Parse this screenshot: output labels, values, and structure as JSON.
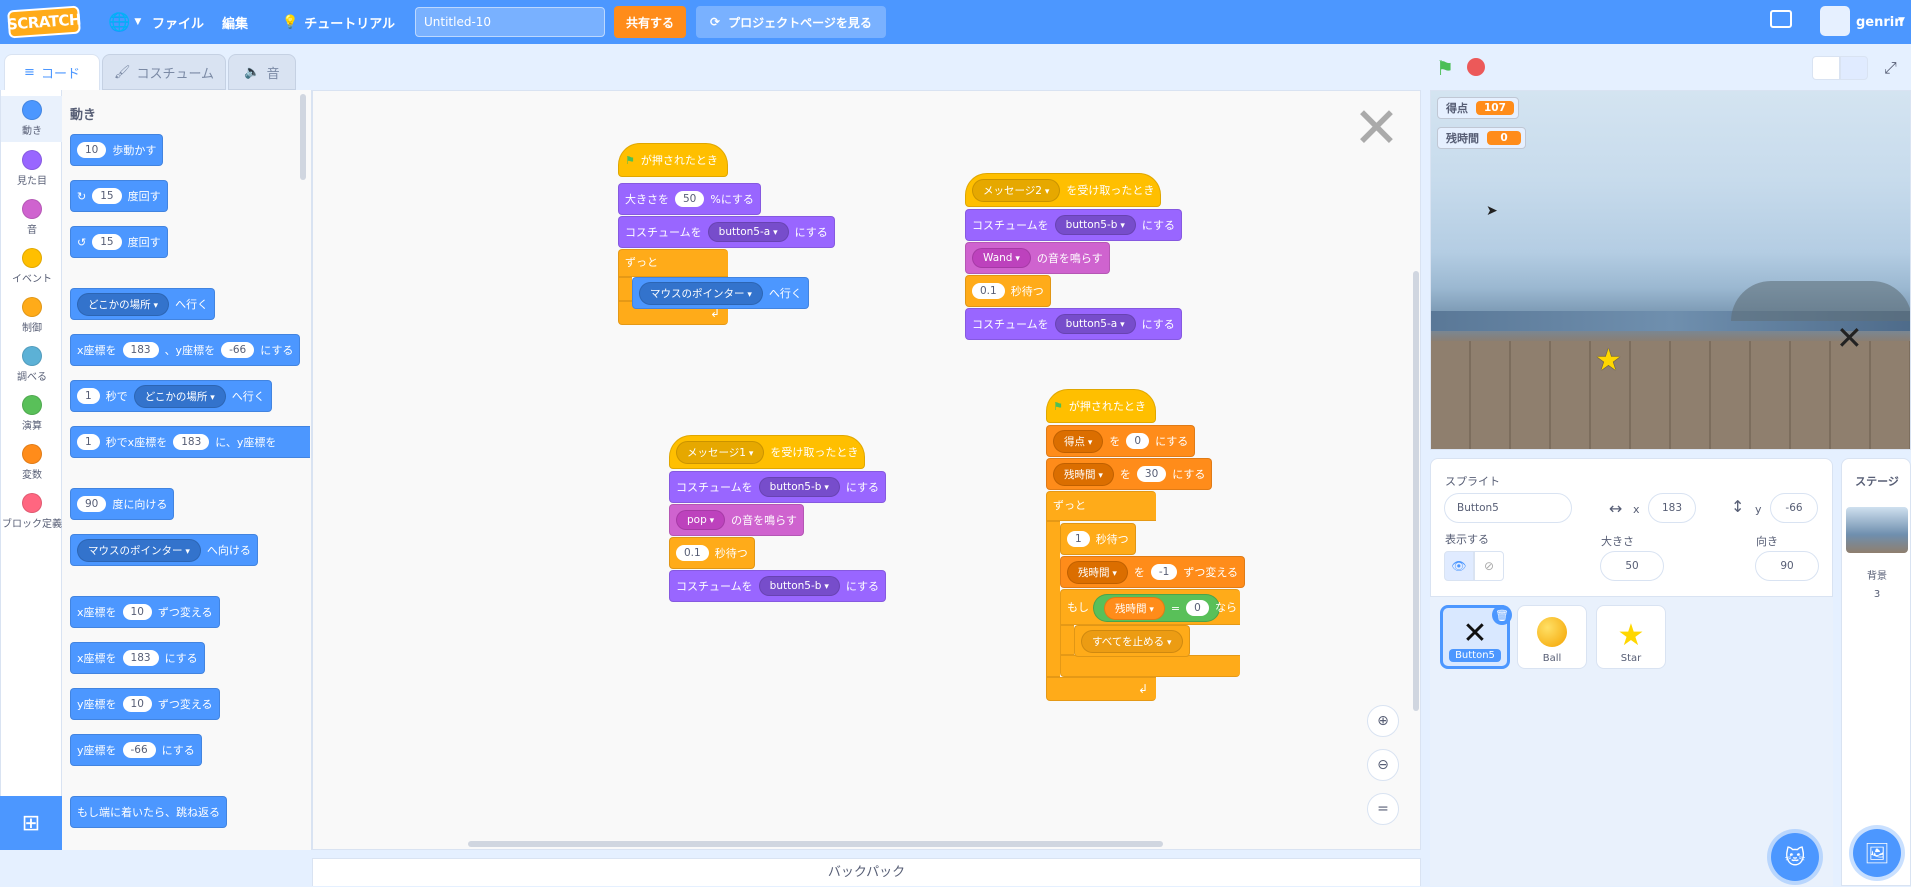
{
  "menubar": {
    "logo": "SCRATCH",
    "file": "ファイル",
    "edit": "編集",
    "tutorial": "チュートリアル",
    "project_title": "Untitled-10",
    "share": "共有する",
    "see_project": "プロジェクトページを見る",
    "username": "genrin"
  },
  "tabs": {
    "code": "コード",
    "costume": "コスチューム",
    "sound": "音"
  },
  "categories": [
    "動き",
    "見た目",
    "音",
    "イベント",
    "制御",
    "調べる",
    "演算",
    "変数",
    "ブロック定義"
  ],
  "category_colors": [
    "#4c97ff",
    "#9966ff",
    "#cf63cf",
    "#ffbf00",
    "#ffab19",
    "#5cb1d6",
    "#59c059",
    "#ff8c1a",
    "#ff6680"
  ],
  "palette": {
    "title": "動き",
    "move_steps": "10",
    "move_label": "歩動かす",
    "turn_right": "15",
    "turn_label": "度回す",
    "turn_left": "15",
    "turn_left_label": "度回す",
    "goto_target": "どこかの場所",
    "goto_label": "へ行く",
    "gotoxy_x_label": "x座標を",
    "gotoxy_x": "183",
    "gotoxy_y_label": "、y座標を",
    "gotoxy_y": "-66",
    "gotoxy_end": "にする",
    "glide_secs": "1",
    "glide_secs_label": "秒で",
    "glide_target": "どこかの場所",
    "glide_label": "へ行く",
    "glidexy_secs": "1",
    "glidexy_label": "秒でx座標を",
    "glidexy_x": "183",
    "glidexy_y_label": "に、y座標を",
    "point_dir": "90",
    "point_label": "度に向ける",
    "point_towards": "マウスのポインター",
    "point_towards_label": "へ向ける",
    "changex_label": "x座標を",
    "changex": "10",
    "changex_end": "ずつ変える",
    "setx_label": "x座標を",
    "setx": "183",
    "setx_end": "にする",
    "changey_label": "y座標を",
    "changey": "10",
    "changey_end": "ずつ変える",
    "sety_label": "y座標を",
    "sety": "-66",
    "sety_end": "にする",
    "bounce": "もし端に着いたら、跳ね返る"
  },
  "scripts": {
    "s1": {
      "hat": "が押されたとき",
      "size_label": "大きさを",
      "size": "50",
      "size_end": "%にする",
      "costume_label": "コスチュームを",
      "costume": "button5-a",
      "costume_end": "にする",
      "forever": "ずっと",
      "goto": "マウスのポインター",
      "goto_end": "へ行く"
    },
    "s2": {
      "msg": "メッセージ2",
      "hat_end": "を受け取ったとき",
      "costume_label": "コスチュームを",
      "costume": "button5-b",
      "costume_end": "にする",
      "sound": "Wand",
      "sound_end": "の音を鳴らす",
      "wait": "0.1",
      "wait_end": "秒待つ",
      "costume2_label": "コスチュームを",
      "costume2": "button5-a",
      "costume2_end": "にする"
    },
    "s3": {
      "msg": "メッセージ1",
      "hat_end": "を受け取ったとき",
      "costume_label": "コスチュームを",
      "costume": "button5-b",
      "costume_end": "にする",
      "sound": "pop",
      "sound_end": "の音を鳴らす",
      "wait": "0.1",
      "wait_end": "秒待つ",
      "costume2_label": "コスチュームを",
      "costume2": "button5-b",
      "costume2_end": "にする"
    },
    "s4": {
      "hat": "が押されたとき",
      "var1": "得点",
      "var1_mid": "を",
      "var1_val": "0",
      "var1_end": "にする",
      "var2": "残時間",
      "var2_mid": "を",
      "var2_val": "30",
      "var2_end": "にする",
      "forever": "ずっと",
      "wait": "1",
      "wait_end": "秒待つ",
      "change_var": "残時間",
      "change_mid": "を",
      "change_val": "-1",
      "change_end": "ずつ変える",
      "if": "もし",
      "cond_var": "残時間",
      "cond_op": "=",
      "cond_val": "0",
      "then": "なら",
      "stop": "すべてを止める"
    }
  },
  "backpack": "バックパック",
  "stage": {
    "monitor1_label": "得点",
    "monitor1_value": "107",
    "monitor2_label": "残時間",
    "monitor2_value": "0"
  },
  "sprite_info": {
    "heading": "スプライト",
    "name": "Button5",
    "x_label": "x",
    "x": "183",
    "y_label": "y",
    "y": "-66",
    "show_label": "表示する",
    "size_label": "大きさ",
    "size": "50",
    "direction_label": "向き",
    "direction": "90"
  },
  "sprites": [
    {
      "name": "Button5",
      "selected": true
    },
    {
      "name": "Ball",
      "selected": false
    },
    {
      "name": "Star",
      "selected": false
    }
  ],
  "stage_pane": {
    "title": "ステージ",
    "backdrop_label": "背景",
    "backdrop_count": "3"
  }
}
